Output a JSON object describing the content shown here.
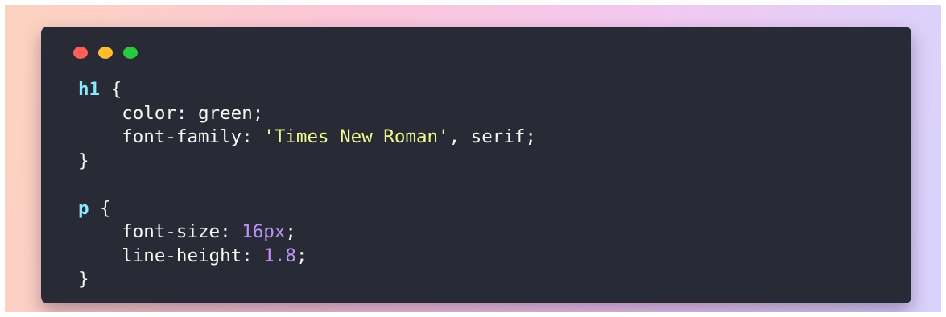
{
  "window_controls": {
    "close_color": "#ff5f56",
    "minimize_color": "#ffbd2e",
    "zoom_color": "#27c93f"
  },
  "code": {
    "line1": {
      "selector": "h1",
      "brace": " {"
    },
    "line2": {
      "indent": "    ",
      "text": "color: green;"
    },
    "line3": {
      "indent": "    ",
      "prop": "font-family: ",
      "string": "'Times New Roman'",
      "rest": ", serif;"
    },
    "line4": {
      "brace": "}"
    },
    "line5": {
      "text": ""
    },
    "line6": {
      "selector": "p",
      "brace": " {"
    },
    "line7": {
      "indent": "    ",
      "prop": "font-size: ",
      "number": "16px",
      "end": ";"
    },
    "line8": {
      "indent": "    ",
      "prop": "line-height: ",
      "number": "1.8",
      "end": ";"
    },
    "line9": {
      "brace": "}"
    }
  },
  "colors": {
    "window_bg": "#282a36",
    "selector": "#8be9fd",
    "string": "#f1fa8c",
    "number": "#bd93f9",
    "text": "#f8f8f2"
  }
}
